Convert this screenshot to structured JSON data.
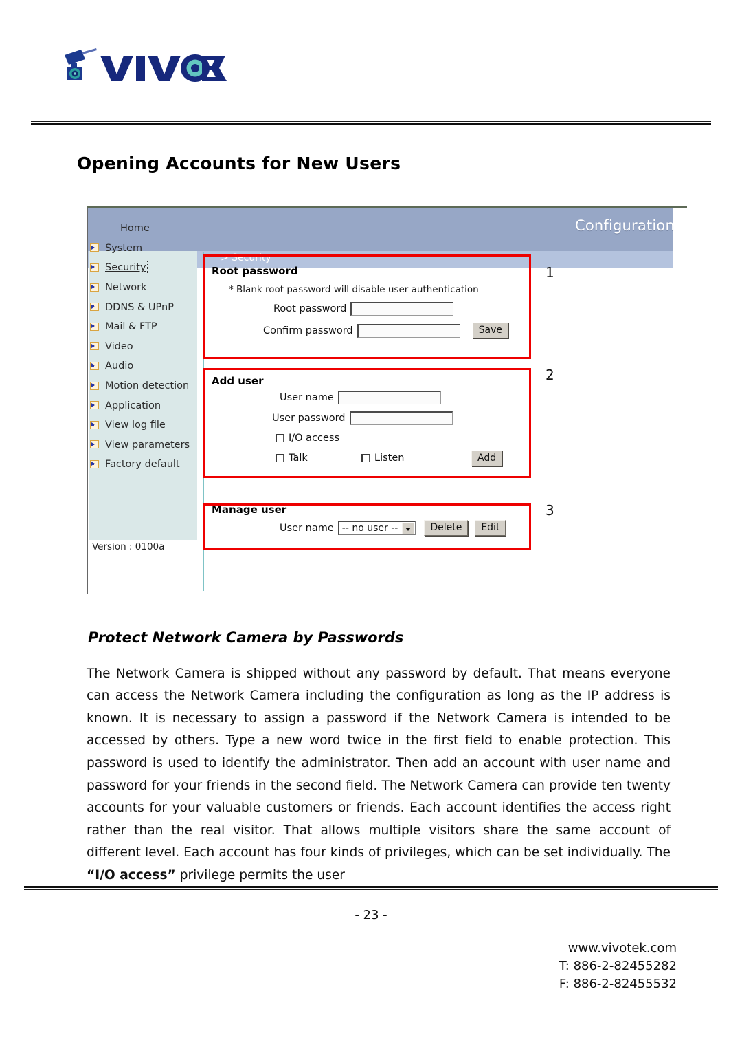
{
  "brand": {
    "logo_text": "VIVOTEK",
    "logo_icon": "camera-icon"
  },
  "page": {
    "title": "Opening Accounts for New Users",
    "number": "- 23 -"
  },
  "screenshot": {
    "header_title": "Configuration",
    "breadcrumb": "> Security",
    "sidebar": {
      "items": [
        {
          "label": "Home",
          "selected": false,
          "has_icon": false
        },
        {
          "label": "System",
          "selected": false,
          "has_icon": true
        },
        {
          "label": "Security",
          "selected": true,
          "has_icon": true
        },
        {
          "label": "Network",
          "selected": false,
          "has_icon": true
        },
        {
          "label": "DDNS & UPnP",
          "selected": false,
          "has_icon": true
        },
        {
          "label": "Mail & FTP",
          "selected": false,
          "has_icon": true
        },
        {
          "label": "Video",
          "selected": false,
          "has_icon": true
        },
        {
          "label": "Audio",
          "selected": false,
          "has_icon": true
        },
        {
          "label": "Motion detection",
          "selected": false,
          "has_icon": true
        },
        {
          "label": "Application",
          "selected": false,
          "has_icon": true
        },
        {
          "label": "View log file",
          "selected": false,
          "has_icon": true
        },
        {
          "label": "View parameters",
          "selected": false,
          "has_icon": true
        },
        {
          "label": "Factory default",
          "selected": false,
          "has_icon": true
        }
      ],
      "version": "Version : 0100a"
    },
    "panels": {
      "root_password": {
        "step": "1",
        "title": "Root password",
        "hint": "* Blank root password will disable user authentication",
        "root_label": "Root password",
        "root_value": "",
        "confirm_label": "Confirm password",
        "confirm_value": "",
        "save_label": "Save"
      },
      "add_user": {
        "step": "2",
        "title": "Add user",
        "username_label": "User name",
        "username_value": "",
        "password_label": "User password",
        "password_value": "",
        "io_access_label": "I/O access",
        "io_access_checked": false,
        "talk_label": "Talk",
        "talk_checked": false,
        "listen_label": "Listen",
        "listen_checked": false,
        "add_label": "Add"
      },
      "manage_user": {
        "step": "3",
        "title": "Manage user",
        "username_label": "User name",
        "select_value": "-- no user --",
        "delete_label": "Delete",
        "edit_label": "Edit"
      }
    },
    "colors": {
      "header_bar": "#97a7c6",
      "sub_bar": "#b4c3de",
      "sidebar_bg": "#dae8e8",
      "highlight_box": "#ee0000",
      "divider": "#7fc3c6"
    }
  },
  "section": {
    "heading": "Protect Network Camera by Passwords",
    "paragraph_part1": "The Network Camera is shipped without any password by default. That means everyone can access the Network Camera including the configuration as long as the IP address is known. It is necessary to assign a password if the Network Camera is intended to be accessed by others. Type a new word twice in the first field to enable protection. This password is used to identify the administrator. Then add an account with user name and password for your friends in the second field. The Network Camera can provide ten twenty accounts for your valuable customers or friends. Each account identifies the access right rather than the real visitor. That allows multiple visitors share the same account of different level. Each account has four kinds of privileges, which can be set individually. The ",
    "paragraph_bold": "“I/O access”",
    "paragraph_part2": " privilege permits the user"
  },
  "footer": {
    "website": "www.vivotek.com",
    "tel": "T: 886-2-82455282",
    "fax": "F: 886-2-82455532"
  }
}
